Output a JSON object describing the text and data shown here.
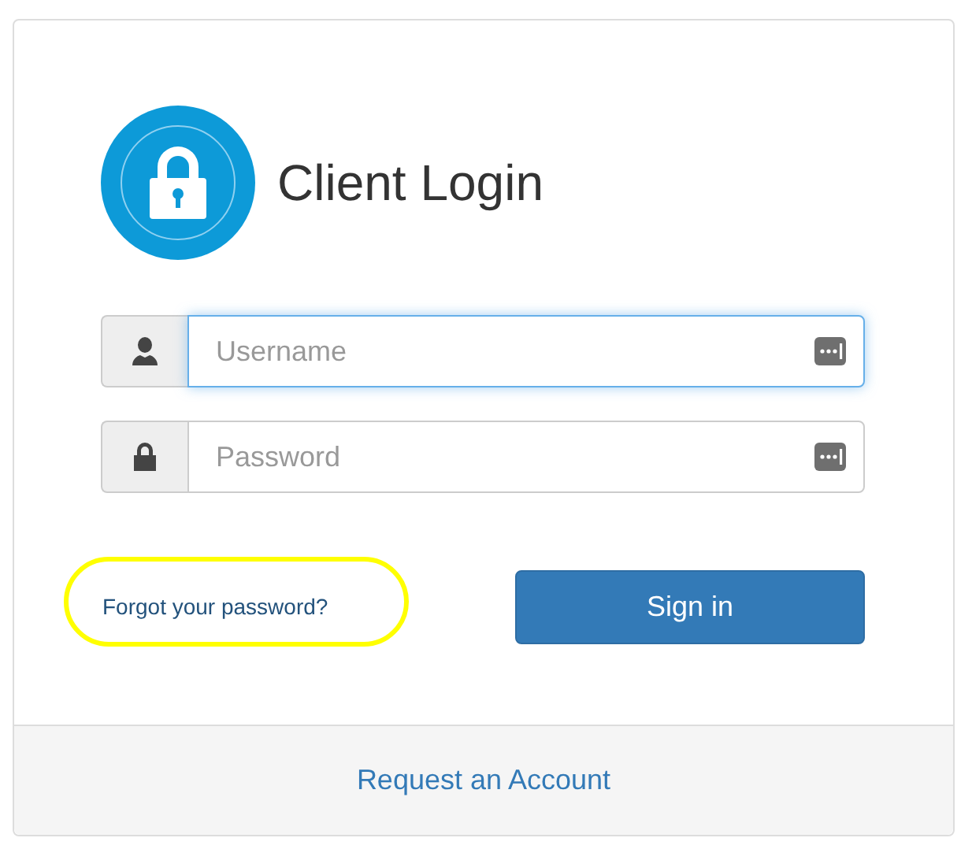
{
  "title": "Client Login",
  "fields": [
    {
      "kind": "user",
      "placeholder": "Username",
      "focused": true
    },
    {
      "kind": "lock",
      "placeholder": "Password",
      "focused": false
    }
  ],
  "forgot_link": {
    "label": "Forgot your password?",
    "highlighted": true
  },
  "sign_in_button": "Sign in",
  "footer_link": "Request an Account"
}
